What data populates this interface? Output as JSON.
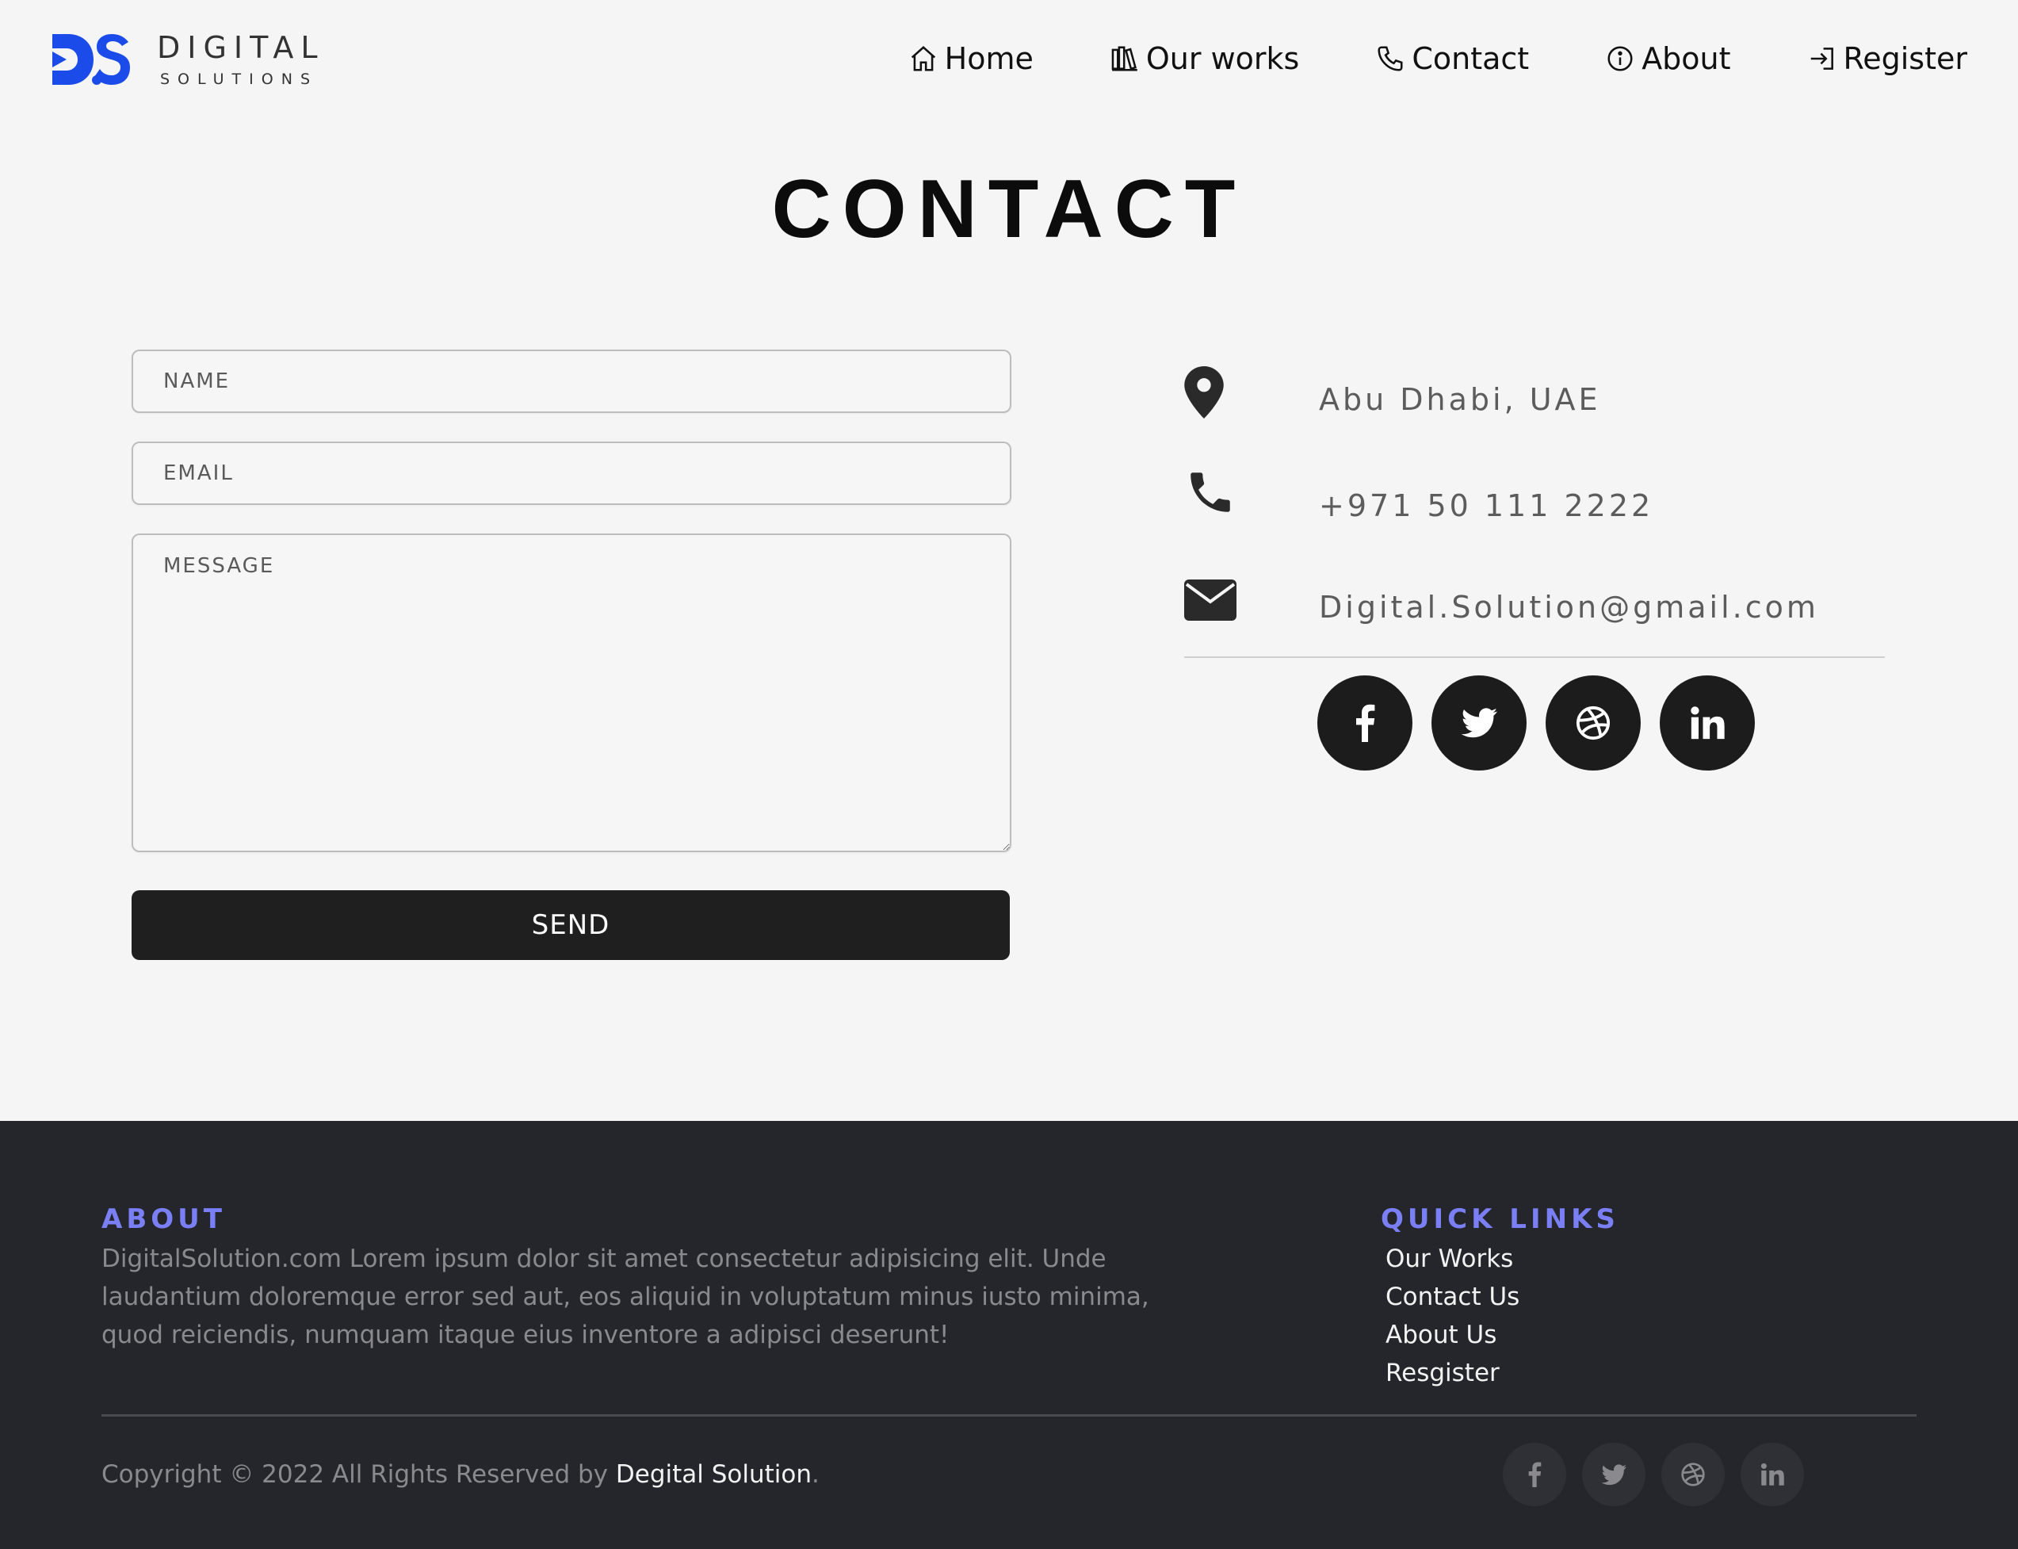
{
  "brand": {
    "title": "DIGITAL",
    "subtitle": "SOLUTIONS",
    "logo_mark": "DS",
    "accent_color": "#1b4be8"
  },
  "nav": {
    "items": [
      {
        "label": "Home",
        "icon": "home-icon"
      },
      {
        "label": "Our works",
        "icon": "books-icon"
      },
      {
        "label": "Contact",
        "icon": "phone-icon"
      },
      {
        "label": "About",
        "icon": "info-icon"
      },
      {
        "label": "Register",
        "icon": "login-icon"
      }
    ]
  },
  "page": {
    "title": "CONTACT"
  },
  "form": {
    "name_placeholder": "NAME",
    "email_placeholder": "EMAIL",
    "message_placeholder": "MESSAGE",
    "send_label": "SEND"
  },
  "contact_info": {
    "location": "Abu Dhabi, UAE",
    "phone": "+971 50 111 2222",
    "email": "Digital.Solution@gmail.com",
    "socials": [
      "facebook-icon",
      "twitter-icon",
      "dribbble-icon",
      "linkedin-icon"
    ]
  },
  "footer": {
    "about_title": "ABOUT",
    "about_text": "DigitalSolution.com Lorem ipsum dolor sit amet consectetur adipisicing elit. Unde laudantium doloremque error sed aut, eos aliquid in voluptatum minus iusto minima, quod reiciendis, numquam itaque eius inventore a adipisci deserunt!",
    "links_title": "QUICK LINKS",
    "links": [
      "Our Works",
      "Contact Us",
      "About Us",
      "Resgister"
    ],
    "copyright_prefix": "Copyright © 2022 All Rights Reserved by ",
    "copyright_brand": "Degital Solution",
    "copyright_suffix": ".",
    "heading_color": "#7a7ff5",
    "background_color": "#25262b"
  }
}
